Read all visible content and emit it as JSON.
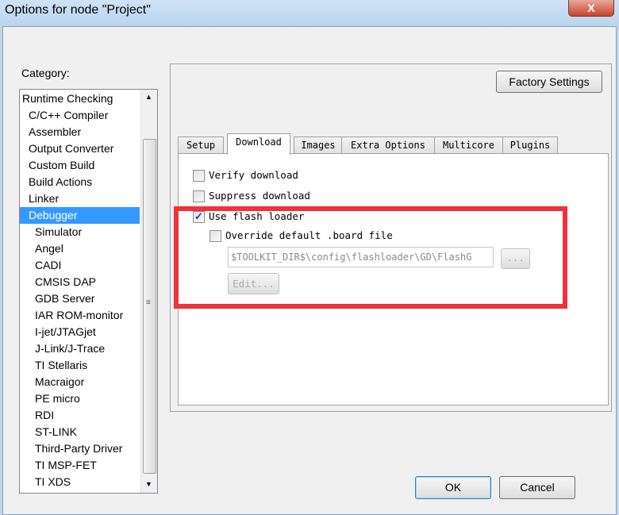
{
  "window": {
    "title": "Options for node \"Project\"",
    "close_label": "X"
  },
  "category": {
    "label": "Category:",
    "items": [
      "Runtime Checking",
      "C/C++ Compiler",
      "Assembler",
      "Output Converter",
      "Custom Build",
      "Build Actions",
      "Linker",
      "Debugger",
      "Simulator",
      "Angel",
      "CADI",
      "CMSIS DAP",
      "GDB Server",
      "IAR ROM-monitor",
      "I-jet/JTAGjet",
      "J-Link/J-Trace",
      "TI Stellaris",
      "Macraigor",
      "PE micro",
      "RDI",
      "ST-LINK",
      "Third-Party Driver",
      "TI MSP-FET",
      "TI XDS"
    ],
    "selected": "Debugger"
  },
  "factory_settings": "Factory Settings",
  "tabs": [
    "Setup",
    "Download",
    "Images",
    "Extra Options",
    "Multicore",
    "Plugins"
  ],
  "active_tab": "Download",
  "download": {
    "verify": {
      "label": "Verify download",
      "checked": false
    },
    "suppress": {
      "label": "Suppress download",
      "checked": false
    },
    "flash_loader": {
      "label": "Use flash loader",
      "checked": true
    },
    "override": {
      "label": "Override default .board file",
      "checked": false
    },
    "board_path": "$TOOLKIT_DIR$\\config\\flashloader\\GD\\FlashG",
    "browse_label": "...",
    "edit_label": "Edit..."
  },
  "ok": "OK",
  "cancel": "Cancel",
  "highlight_color": "#f0323a"
}
